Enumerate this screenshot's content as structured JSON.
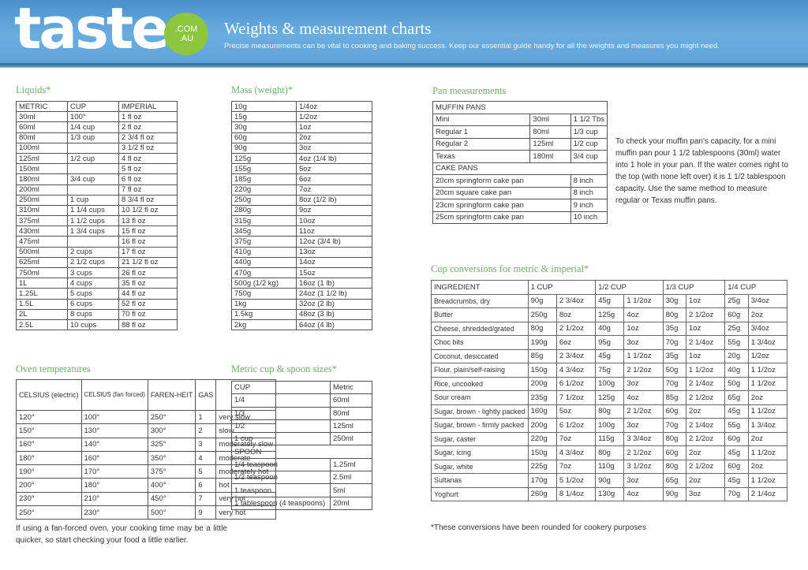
{
  "header": {
    "logo_text": "taste",
    "logo_badge_line1": ".COM",
    "logo_badge_line2": ".AU",
    "title": "Weights & measurement charts",
    "subtitle": "Precise measurements can be vital to cooking and baking success. Keep our essential guide handy for all the weights and measures you might need."
  },
  "liquids": {
    "title": "Liquids*",
    "headers": [
      "METRIC",
      "CUP",
      "IMPERIAL"
    ],
    "rows": [
      [
        "30ml",
        "100°",
        "1 fl  oz"
      ],
      [
        "60ml",
        "1/4 cup",
        "2 fl  oz"
      ],
      [
        "80ml",
        "1/3 cup",
        "2 3/4 fl  oz"
      ],
      [
        "100ml",
        "",
        "3 1/2 fl  oz"
      ],
      [
        "125ml",
        "1/2 cup",
        "4 fl  oz"
      ],
      [
        "150ml",
        "",
        "5 fl  oz"
      ],
      [
        "180ml",
        "3/4 cup",
        "6 fl  oz"
      ],
      [
        "200ml",
        "",
        "7 fl  oz"
      ],
      [
        "250ml",
        "1 cup",
        "8 3/4 fl  oz"
      ],
      [
        "310ml",
        "1 1/4 cups",
        "10 1/2 fl  oz"
      ],
      [
        "375ml",
        "1 1/2 cups",
        "13 fl  oz"
      ],
      [
        "430ml",
        "1 3/4 cups",
        "15 fl  oz"
      ],
      [
        "475ml",
        "",
        "16 fl  oz"
      ],
      [
        "500ml",
        "2 cups",
        "17 fl  oz"
      ],
      [
        "625ml",
        "2 1/2 cups",
        "21 1/2 fl oz"
      ],
      [
        "750ml",
        "3 cups",
        "26 fl  oz"
      ],
      [
        "1L",
        "4 cups",
        "35 fl  oz"
      ],
      [
        "1.25L",
        "5 cups",
        "44 fl  oz"
      ],
      [
        "1.5L",
        "6 cups",
        "52 fl  oz"
      ],
      [
        "2L",
        "8 cups",
        "70 fl  oz"
      ],
      [
        "2.5L",
        "10 cups",
        "88 fl  oz"
      ]
    ]
  },
  "mass": {
    "title": "Mass (weight)*",
    "rows": [
      [
        "10g",
        "1/4oz"
      ],
      [
        "15g",
        "1/2oz"
      ],
      [
        "30g",
        "1oz"
      ],
      [
        "60g",
        "2oz"
      ],
      [
        "90g",
        "3oz"
      ],
      [
        "125g",
        "4oz (1/4 lb)"
      ],
      [
        "155g",
        "5oz"
      ],
      [
        "185g",
        "6oz"
      ],
      [
        "220g",
        "7oz"
      ],
      [
        "250g",
        "8oz (1/2 lb)"
      ],
      [
        "280g",
        "9oz"
      ],
      [
        "315g",
        "10oz"
      ],
      [
        "345g",
        "11oz"
      ],
      [
        "375g",
        "12oz (3/4 lb)"
      ],
      [
        "410g",
        "13oz"
      ],
      [
        "440g",
        "14oz"
      ],
      [
        "470g",
        "15oz"
      ],
      [
        "500g (1/2 kg)",
        "16oz (1 lb)"
      ],
      [
        "750g",
        "24oz (1 1/2 lb)"
      ],
      [
        "1kg",
        "32oz (2 lb)"
      ],
      [
        "1.5kg",
        "48oz (3 lb)"
      ],
      [
        "2kg",
        "64oz (4 lb)"
      ]
    ]
  },
  "oven": {
    "title": "Oven temperatures",
    "headers": [
      "CELSIUS (electric)",
      "CELSIUS (fan forced)",
      "FAREN-HEIT",
      "GAS",
      ""
    ],
    "rows": [
      [
        "120°",
        "100°",
        "250°",
        "1",
        "very slow"
      ],
      [
        "150°",
        "130°",
        "300°",
        "2",
        "slow"
      ],
      [
        "160°",
        "140°",
        "325°",
        "3",
        "moderately slow"
      ],
      [
        "180°",
        "160°",
        "350°",
        "4",
        "moderate"
      ],
      [
        "190°",
        "170°",
        "375°",
        "5",
        "moderately hot"
      ],
      [
        "200°",
        "180°",
        "400°",
        "6",
        "hot"
      ],
      [
        "230°",
        "210°",
        "450°",
        "7",
        "very hot"
      ],
      [
        "250°",
        "230°",
        "500°",
        "9",
        "very hot"
      ]
    ],
    "note": "If using a fan-forced oven, your cooking time may be a little quicker, so start checking your food a little earlier."
  },
  "spoons": {
    "title": "Metric cup & spoon sizes*",
    "cup_header": [
      "CUP",
      "Metric"
    ],
    "cup_rows": [
      [
        "1/4",
        "60ml"
      ],
      [
        "1/3",
        "80ml"
      ],
      [
        "1/2",
        "125ml"
      ],
      [
        "1 cup",
        "250ml"
      ]
    ],
    "spoon_header": "SPOON",
    "spoon_rows": [
      [
        "1/4 teaspoon",
        "1.25ml"
      ],
      [
        "1/2 teaspoon",
        "2.5ml"
      ],
      [
        "1 teaspoon",
        "5ml"
      ],
      [
        "1 tablespoon (4 teaspoons)",
        "20ml"
      ]
    ]
  },
  "pans": {
    "title": "Pan measurements",
    "muffin_header": "MUFFIN PANS",
    "muffin_rows": [
      [
        "Mini",
        "30ml",
        "1 1/2 Tbs"
      ],
      [
        "Regular 1",
        "80ml",
        "1/3 cup"
      ],
      [
        "Regular 2",
        "125ml",
        "1/2 cup"
      ],
      [
        "Texas",
        "180ml",
        "3/4 cup"
      ]
    ],
    "cake_header": "CAKE PANS",
    "cake_rows": [
      [
        "20cm springform cake pan",
        "8 inch"
      ],
      [
        "20cm square cake pan",
        "8 inch"
      ],
      [
        "23cm springform cake pan",
        "9 inch"
      ],
      [
        "25cm springform cake pan",
        "10 inch"
      ]
    ],
    "note": "To check your muffin pan's capacity, for a mini muffin pan pour 1 1/2 tablespoons (30ml) water into 1 hole in your pan. If the water comes right to the top (with none left over) it is 1 1/2 tablespoon capacity. Use the same method to measure regular or Texas muffin pans."
  },
  "cups": {
    "title": "Cup conversions for metric & imperial*",
    "headers": [
      "INGREDIENT",
      "1 CUP",
      "1/2 CUP",
      "1/3 CUP",
      "1/4 CUP"
    ],
    "rows": [
      [
        "Breadcrumbs, dry",
        "90g",
        "2 3/4oz",
        "45g",
        "1 1/2oz",
        "30g",
        "1oz",
        "25g",
        "3/4oz"
      ],
      [
        "Butter",
        "250g",
        "8oz",
        "125g",
        "4oz",
        "80g",
        "2 1/2oz",
        "60g",
        "2oz"
      ],
      [
        "Cheese, shredded/grated",
        "80g",
        "2 1/2oz",
        "40g",
        "1oz",
        "35g",
        "1oz",
        "25g",
        "3/4oz"
      ],
      [
        "Choc bits",
        "190g",
        "6oz",
        "95g",
        "3oz",
        "70g",
        "2 1/4oz",
        "55g",
        "1 3/4oz"
      ],
      [
        "Coconut, desiccated",
        "85g",
        "2 3/4oz",
        "45g",
        "1 1/2oz",
        "35g",
        "1oz",
        "20g",
        "1/2oz"
      ],
      [
        "Flour, plain/self-raising",
        "150g",
        "4 3/4oz",
        "75g",
        "2 1/2oz",
        "50g",
        "1 1/2oz",
        "40g",
        "1 1/2oz"
      ],
      [
        "Rice, uncooked",
        "200g",
        "6 1/2oz",
        "100g",
        "3oz",
        "70g",
        "2 1/4oz",
        "50g",
        "1 1/2oz"
      ],
      [
        "Sour cream",
        "235g",
        "7 1/2oz",
        "125g",
        "4oz",
        "85g",
        "2 1/2oz",
        "65g",
        "2oz"
      ],
      [
        "Sugar, brown - lightly packed",
        "160g",
        "5oz",
        "80g",
        "2 1/2oz",
        "60g",
        "2oz",
        "45g",
        "1 1/2oz"
      ],
      [
        "Sugar, brown - firmly packed",
        "200g",
        "6 1/2oz",
        "100g",
        "3oz",
        "70g",
        "2 1/4oz",
        "55g",
        "1 3/4oz"
      ],
      [
        "Sugar, caster",
        "220g",
        "7oz",
        "115g",
        "3 3/4oz",
        "80g",
        "2 1/2oz",
        "60g",
        "2oz"
      ],
      [
        "Sugar, icing",
        "150g",
        "4 3/4oz",
        "80g",
        "2 1/2oz",
        "60g",
        "2oz",
        "45g",
        "1 1/2oz"
      ],
      [
        "Sugar, white",
        "225g",
        "7oz",
        "110g",
        "3 1/2oz",
        "80g",
        "2 1/2oz",
        "60g",
        "2oz"
      ],
      [
        "Sultanas",
        "170g",
        "5 1/2oz",
        "90g",
        "3oz",
        "65g",
        "2oz",
        "45g",
        "1 1/2oz"
      ],
      [
        "Yoghurt",
        "260g",
        "8 1/4oz",
        "130g",
        "4oz",
        "90g",
        "3oz",
        "70g",
        "2 1/4oz"
      ]
    ],
    "note": "*These conversions have been rounded for cookery purposes"
  }
}
